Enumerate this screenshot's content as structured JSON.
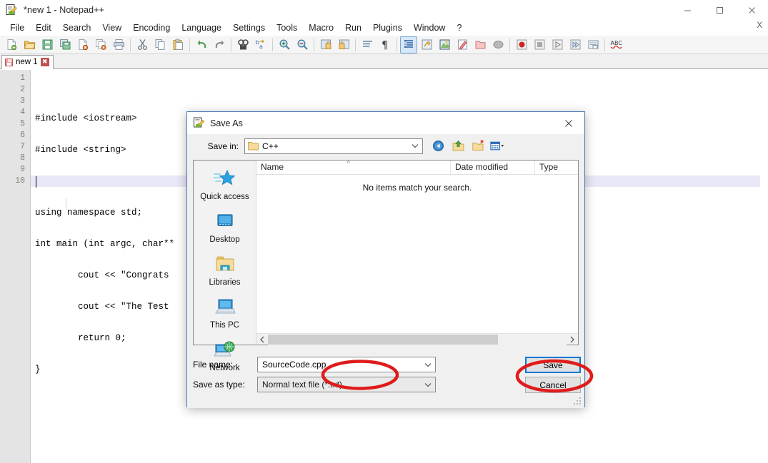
{
  "window": {
    "title": "*new 1 - Notepad++",
    "app_icon": "notepad-plus-plus-icon",
    "controls": {
      "minimize": "–",
      "maximize": "□",
      "close": "✕",
      "doc_close": "X"
    }
  },
  "menu": {
    "items": [
      {
        "label": "File"
      },
      {
        "label": "Edit"
      },
      {
        "label": "Search"
      },
      {
        "label": "View"
      },
      {
        "label": "Encoding"
      },
      {
        "label": "Language"
      },
      {
        "label": "Settings"
      },
      {
        "label": "Tools"
      },
      {
        "label": "Macro"
      },
      {
        "label": "Run"
      },
      {
        "label": "Plugins"
      },
      {
        "label": "Window"
      },
      {
        "label": "?"
      }
    ]
  },
  "toolbar": {
    "buttons": [
      {
        "name": "new-file-icon",
        "title": "New"
      },
      {
        "name": "open-file-icon",
        "title": "Open"
      },
      {
        "name": "save-icon",
        "title": "Save"
      },
      {
        "name": "save-all-icon",
        "title": "Save All"
      },
      {
        "name": "close-file-icon",
        "title": "Close"
      },
      {
        "name": "close-all-icon",
        "title": "Close All"
      },
      {
        "name": "print-icon",
        "title": "Print"
      },
      {
        "name": "separator",
        "title": ""
      },
      {
        "name": "cut-icon",
        "title": "Cut"
      },
      {
        "name": "copy-icon",
        "title": "Copy"
      },
      {
        "name": "paste-icon",
        "title": "Paste"
      },
      {
        "name": "separator",
        "title": ""
      },
      {
        "name": "undo-icon",
        "title": "Undo"
      },
      {
        "name": "redo-icon",
        "title": "Redo"
      },
      {
        "name": "separator",
        "title": ""
      },
      {
        "name": "find-icon",
        "title": "Find"
      },
      {
        "name": "replace-icon",
        "title": "Replace"
      },
      {
        "name": "separator",
        "title": ""
      },
      {
        "name": "zoom-in-icon",
        "title": "Zoom In"
      },
      {
        "name": "zoom-out-icon",
        "title": "Zoom Out"
      },
      {
        "name": "separator",
        "title": ""
      },
      {
        "name": "sync-vertical-icon",
        "title": "Synchronize Vertical Scrolling"
      },
      {
        "name": "sync-horizontal-icon",
        "title": "Synchronize Horizontal Scrolling"
      },
      {
        "name": "separator",
        "title": ""
      },
      {
        "name": "word-wrap-icon",
        "title": "Word Wrap"
      },
      {
        "name": "show-all-chars-icon",
        "title": "Show All Characters"
      },
      {
        "name": "separator",
        "title": ""
      },
      {
        "name": "indent-guide-icon",
        "title": "Show Indent Guide"
      },
      {
        "name": "user-language-icon",
        "title": "User-Defined Language"
      },
      {
        "name": "doc-map-icon",
        "title": "Document Map"
      },
      {
        "name": "function-list-icon",
        "title": "Function List"
      },
      {
        "name": "folder-workspace-icon",
        "title": "Folder as Workspace"
      },
      {
        "name": "monitor-icon",
        "title": "Monitoring"
      },
      {
        "name": "separator",
        "title": ""
      },
      {
        "name": "record-macro-icon",
        "title": "Start Recording"
      },
      {
        "name": "stop-macro-icon",
        "title": "Stop Recording"
      },
      {
        "name": "play-macro-icon",
        "title": "Playback"
      },
      {
        "name": "run-macro-multi-icon",
        "title": "Run a Macro Multiple Times"
      },
      {
        "name": "save-macro-icon",
        "title": "Save Current Recorded Macro"
      },
      {
        "name": "separator",
        "title": ""
      },
      {
        "name": "spell-check-icon",
        "title": "ABC Spell Check"
      }
    ]
  },
  "tabs": [
    {
      "label": "new 1",
      "modified": true,
      "close": "✖"
    }
  ],
  "editor": {
    "line_numbers": [
      "1",
      "2",
      "3",
      "4",
      "5",
      "6",
      "7",
      "8",
      "9",
      "10"
    ],
    "lines": [
      "#include <iostream>",
      "#include <string>",
      "",
      "using namespace std;",
      "int main (int argc, char**",
      "        cout << \"Congrats ",
      "        cout << \"The Test ",
      "        return 0;",
      "}",
      ""
    ],
    "current_line": 10
  },
  "dialog": {
    "title": "Save As",
    "icon": "notepad-plus-plus-icon",
    "close_label": "✕",
    "save_in": {
      "label": "Save in:",
      "value": "C++",
      "folder_icon": "folder-icon",
      "dropdown_icon": "chevron-down-icon"
    },
    "nav_buttons": [
      {
        "name": "back-icon",
        "title": "Back"
      },
      {
        "name": "up-folder-icon",
        "title": "Up One Level"
      },
      {
        "name": "new-folder-icon",
        "title": "Create New Folder"
      },
      {
        "name": "views-icon",
        "title": "Views"
      }
    ],
    "places": [
      {
        "label": "Quick access",
        "icon": "quick-access-star-icon"
      },
      {
        "label": "Desktop",
        "icon": "desktop-monitor-icon"
      },
      {
        "label": "Libraries",
        "icon": "libraries-folder-icon"
      },
      {
        "label": "This PC",
        "icon": "this-pc-computer-icon"
      },
      {
        "label": "Network",
        "icon": "network-globe-icon"
      }
    ],
    "columns": [
      {
        "label": "Name",
        "sorted": "asc",
        "sort_icon": "˄"
      },
      {
        "label": "Date modified",
        "sorted": ""
      },
      {
        "label": "Type",
        "sorted": ""
      }
    ],
    "empty_message": "No items match your search.",
    "file_name": {
      "label": "File name:",
      "value": "SourceCode.cpp",
      "dropdown_icon": "chevron-down-icon"
    },
    "save_as_type": {
      "label": "Save as type:",
      "value": "Normal text file (*.txt)",
      "dropdown_icon": "chevron-down-icon"
    },
    "buttons": {
      "save": "Save",
      "cancel": "Cancel"
    },
    "resize_grip": "resize-grip-icon"
  },
  "annotations": [
    {
      "name": "filename-highlight-ellipse",
      "target": "file-name-field",
      "color": "#e01b1b"
    },
    {
      "name": "save-button-highlight-ellipse",
      "target": "save-button",
      "color": "#e01b1b"
    }
  ],
  "colors": {
    "accent": "#0078d7",
    "annotation_red": "#e01b1b",
    "toolbar_bg": "#f5f5f5",
    "gutter_bg": "#e4e4e4",
    "current_line": "#e8e8f8",
    "dialog_bg": "#f0f0f0"
  }
}
